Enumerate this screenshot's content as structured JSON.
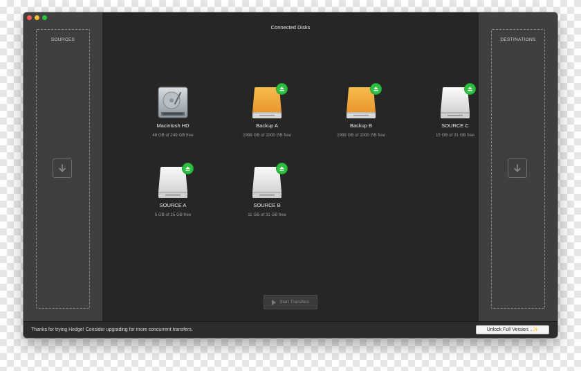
{
  "window": {
    "main_title": "Connected Disks",
    "sources_label": "SOURCES",
    "destinations_label": "DESTINATIONS"
  },
  "disks": [
    {
      "name": "Macintosh HD",
      "free": "48 GB of 249 GB free",
      "icon": "internal-hard-drive-icon",
      "ejectable": false
    },
    {
      "name": "Backup A",
      "free": "1998 GB of 2000 GB free",
      "icon": "external-drive-orange-icon",
      "ejectable": true
    },
    {
      "name": "Backup B",
      "free": "1999 GB of 2000 GB free",
      "icon": "external-drive-orange-icon",
      "ejectable": true
    },
    {
      "name": "SOURCE C",
      "free": "15 GB of 31 GB free",
      "icon": "external-drive-white-icon",
      "ejectable": true
    },
    {
      "name": "SOURCE A",
      "free": "5 GB of 15 GB free",
      "icon": "external-drive-white-icon",
      "ejectable": true
    },
    {
      "name": "SOURCE B",
      "free": "11 GB of 31 GB free",
      "icon": "external-drive-white-icon",
      "ejectable": true
    }
  ],
  "actions": {
    "start_transfers": "Start Transfers"
  },
  "footer": {
    "message": "Thanks for trying Hedge! Consider upgrading for more concurrent transfers.",
    "unlock_label": "Unlock Full Version...✨"
  },
  "colors": {
    "eject_green": "#2fbf43",
    "drive_orange": "#f0a53a",
    "window_bg": "#262626",
    "sidebar_bg": "#3f3f3f"
  }
}
